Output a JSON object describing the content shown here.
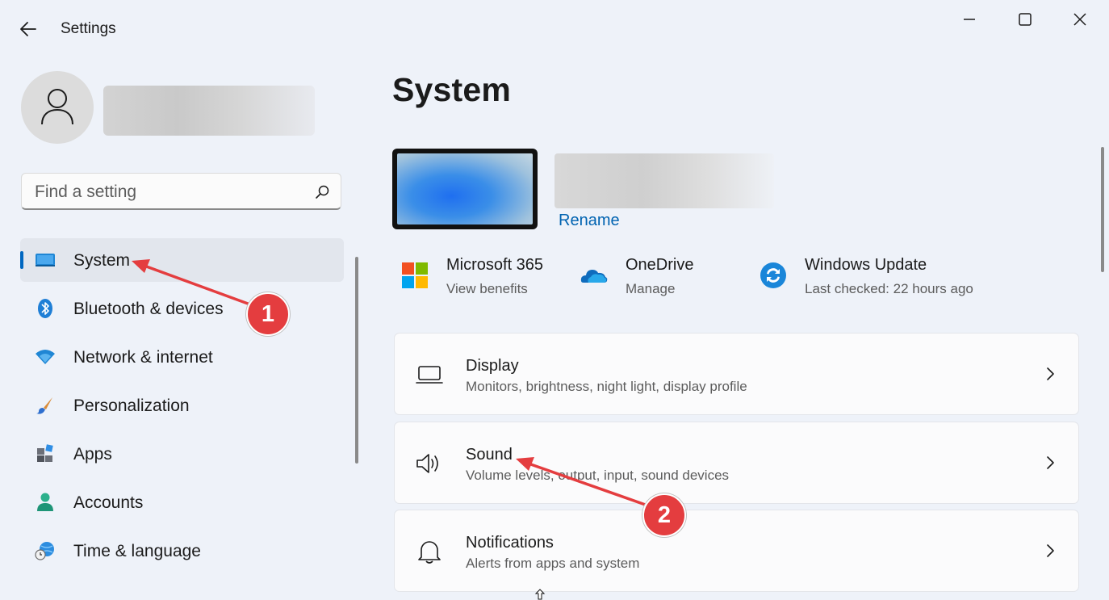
{
  "window": {
    "title": "Settings",
    "controls": {
      "minimize": "minimize-icon",
      "maximize": "maximize-icon",
      "close": "close-icon"
    }
  },
  "sidebar": {
    "search": {
      "placeholder": "Find a setting",
      "value": ""
    },
    "items": [
      {
        "label": "System",
        "icon": "system-icon",
        "selected": true
      },
      {
        "label": "Bluetooth & devices",
        "icon": "bluetooth-icon",
        "selected": false
      },
      {
        "label": "Network & internet",
        "icon": "wifi-icon",
        "selected": false
      },
      {
        "label": "Personalization",
        "icon": "brush-icon",
        "selected": false
      },
      {
        "label": "Apps",
        "icon": "apps-icon",
        "selected": false
      },
      {
        "label": "Accounts",
        "icon": "person-icon",
        "selected": false
      },
      {
        "label": "Time & language",
        "icon": "globe-clock-icon",
        "selected": false
      }
    ]
  },
  "main": {
    "title": "System",
    "device": {
      "rename_label": "Rename"
    },
    "quick_links": [
      {
        "title": "Microsoft 365",
        "subtitle": "View benefits",
        "icon": "microsoft-logo-icon"
      },
      {
        "title": "OneDrive",
        "subtitle": "Manage",
        "icon": "cloud-icon"
      },
      {
        "title": "Windows Update",
        "subtitle": "Last checked: 22 hours ago",
        "icon": "sync-icon"
      }
    ],
    "cards": [
      {
        "title": "Display",
        "subtitle": "Monitors, brightness, night light, display profile",
        "icon": "laptop-icon"
      },
      {
        "title": "Sound",
        "subtitle": "Volume levels, output, input, sound devices",
        "icon": "speaker-icon"
      },
      {
        "title": "Notifications",
        "subtitle": "Alerts from apps and system",
        "icon": "bell-icon"
      }
    ]
  },
  "annotations": {
    "step_1": "1",
    "step_2": "2",
    "color": "#e43d3f"
  },
  "colors": {
    "accent": "#0067c0",
    "background": "#eef2f9",
    "link": "#0063b1"
  }
}
